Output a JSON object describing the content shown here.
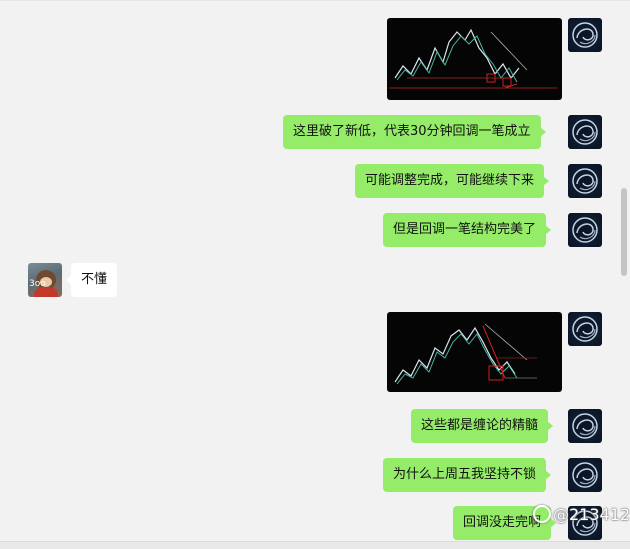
{
  "messages": {
    "m3": "这里破了新低，代表30分钟回调一笔成立",
    "m4": "可能调整完成，可能继续下来",
    "m5": "但是回调一笔结构完美了",
    "m6": "不懂",
    "m8": "这些都是缠论的精髓",
    "m9": "为什么上周五我坚持不锁",
    "m10": "回调没走完啊"
  },
  "avatar_other_tag": "3oo",
  "watermark": "@213412"
}
